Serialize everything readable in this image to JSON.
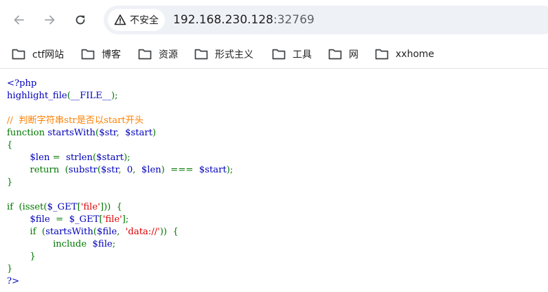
{
  "toolbar": {
    "back_icon": "arrow-left-icon",
    "forward_icon": "arrow-right-icon",
    "reload_icon": "reload-icon",
    "security_icon": "warning-triangle-icon",
    "security_label": "不安全",
    "url_host": "192.168.230.128",
    "url_port": ":32769"
  },
  "bookmarks": [
    {
      "label": "ctf网站",
      "icon": "folder-icon"
    },
    {
      "label": "博客",
      "icon": "folder-icon"
    },
    {
      "label": "资源",
      "icon": "folder-icon"
    },
    {
      "label": "形式主义",
      "icon": "folder-icon"
    },
    {
      "label": "工具",
      "icon": "folder-icon"
    },
    {
      "label": "网",
      "icon": "folder-icon"
    },
    {
      "label": "xxhome",
      "icon": "folder-icon"
    }
  ],
  "colors": {
    "default": "#0000bb",
    "keyword": "#007700",
    "string": "#dd0000",
    "comment": "#ff8000",
    "html": "#000000"
  },
  "code": {
    "lines": [
      [
        {
          "t": "<?php",
          "c": "default"
        }
      ],
      [
        {
          "t": "highlight_file",
          "c": "default"
        },
        {
          "t": "(",
          "c": "keyword"
        },
        {
          "t": "__FILE__",
          "c": "default"
        },
        {
          "t": ");",
          "c": "keyword"
        }
      ],
      [],
      [
        {
          "t": "//  判断字符串str是否以start开头",
          "c": "comment"
        }
      ],
      [
        {
          "t": "function ",
          "c": "keyword"
        },
        {
          "t": "startsWith",
          "c": "default"
        },
        {
          "t": "(",
          "c": "keyword"
        },
        {
          "t": "$str",
          "c": "default"
        },
        {
          "t": ",  ",
          "c": "keyword"
        },
        {
          "t": "$start",
          "c": "default"
        },
        {
          "t": ")",
          "c": "keyword"
        }
      ],
      [
        {
          "t": "{",
          "c": "keyword"
        }
      ],
      [
        {
          "t": "        ",
          "c": "keyword"
        },
        {
          "t": "$len ",
          "c": "default"
        },
        {
          "t": "=  ",
          "c": "keyword"
        },
        {
          "t": "strlen",
          "c": "default"
        },
        {
          "t": "(",
          "c": "keyword"
        },
        {
          "t": "$start",
          "c": "default"
        },
        {
          "t": ");",
          "c": "keyword"
        }
      ],
      [
        {
          "t": "        return  ",
          "c": "keyword"
        },
        {
          "t": "(",
          "c": "keyword"
        },
        {
          "t": "substr",
          "c": "default"
        },
        {
          "t": "(",
          "c": "keyword"
        },
        {
          "t": "$str",
          "c": "default"
        },
        {
          "t": ",  ",
          "c": "keyword"
        },
        {
          "t": "0",
          "c": "default"
        },
        {
          "t": ",  ",
          "c": "keyword"
        },
        {
          "t": "$len",
          "c": "default"
        },
        {
          "t": ")  ===  ",
          "c": "keyword"
        },
        {
          "t": "$start",
          "c": "default"
        },
        {
          "t": ");",
          "c": "keyword"
        }
      ],
      [
        {
          "t": "}",
          "c": "keyword"
        }
      ],
      [],
      [
        {
          "t": "if  ",
          "c": "keyword"
        },
        {
          "t": "(isset(",
          "c": "keyword"
        },
        {
          "t": "$_GET",
          "c": "default"
        },
        {
          "t": "[",
          "c": "keyword"
        },
        {
          "t": "'file'",
          "c": "string"
        },
        {
          "t": "]))  {",
          "c": "keyword"
        }
      ],
      [
        {
          "t": "        ",
          "c": "keyword"
        },
        {
          "t": "$file  ",
          "c": "default"
        },
        {
          "t": "=  ",
          "c": "keyword"
        },
        {
          "t": "$_GET",
          "c": "default"
        },
        {
          "t": "[",
          "c": "keyword"
        },
        {
          "t": "'file'",
          "c": "string"
        },
        {
          "t": "];",
          "c": "keyword"
        }
      ],
      [
        {
          "t": "        if  ",
          "c": "keyword"
        },
        {
          "t": "(",
          "c": "keyword"
        },
        {
          "t": "startsWith",
          "c": "default"
        },
        {
          "t": "(",
          "c": "keyword"
        },
        {
          "t": "$file",
          "c": "default"
        },
        {
          "t": ",  ",
          "c": "keyword"
        },
        {
          "t": "'data://'",
          "c": "string"
        },
        {
          "t": "))  {",
          "c": "keyword"
        }
      ],
      [
        {
          "t": "                include  ",
          "c": "keyword"
        },
        {
          "t": "$file",
          "c": "default"
        },
        {
          "t": ";",
          "c": "keyword"
        }
      ],
      [
        {
          "t": "        }",
          "c": "keyword"
        }
      ],
      [
        {
          "t": "}",
          "c": "keyword"
        }
      ],
      [
        {
          "t": "?>",
          "c": "default"
        }
      ]
    ]
  }
}
